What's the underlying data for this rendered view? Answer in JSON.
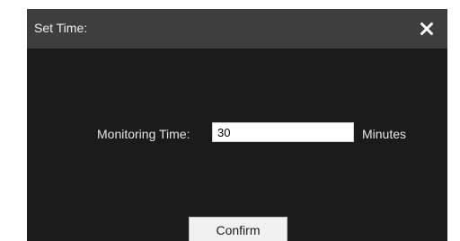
{
  "dialog": {
    "title": "Set Time:",
    "close_icon": "close-icon"
  },
  "form": {
    "monitoring_label": "Monitoring Time:",
    "monitoring_value": "30",
    "unit_label": "Minutes"
  },
  "actions": {
    "confirm_label": "Confirm"
  },
  "colors": {
    "titlebar": "#3e3e3e",
    "body": "#1b1b1b",
    "text": "#e6e6e6",
    "input_bg": "#ffffff",
    "button_bg": "#f1f1f1"
  }
}
